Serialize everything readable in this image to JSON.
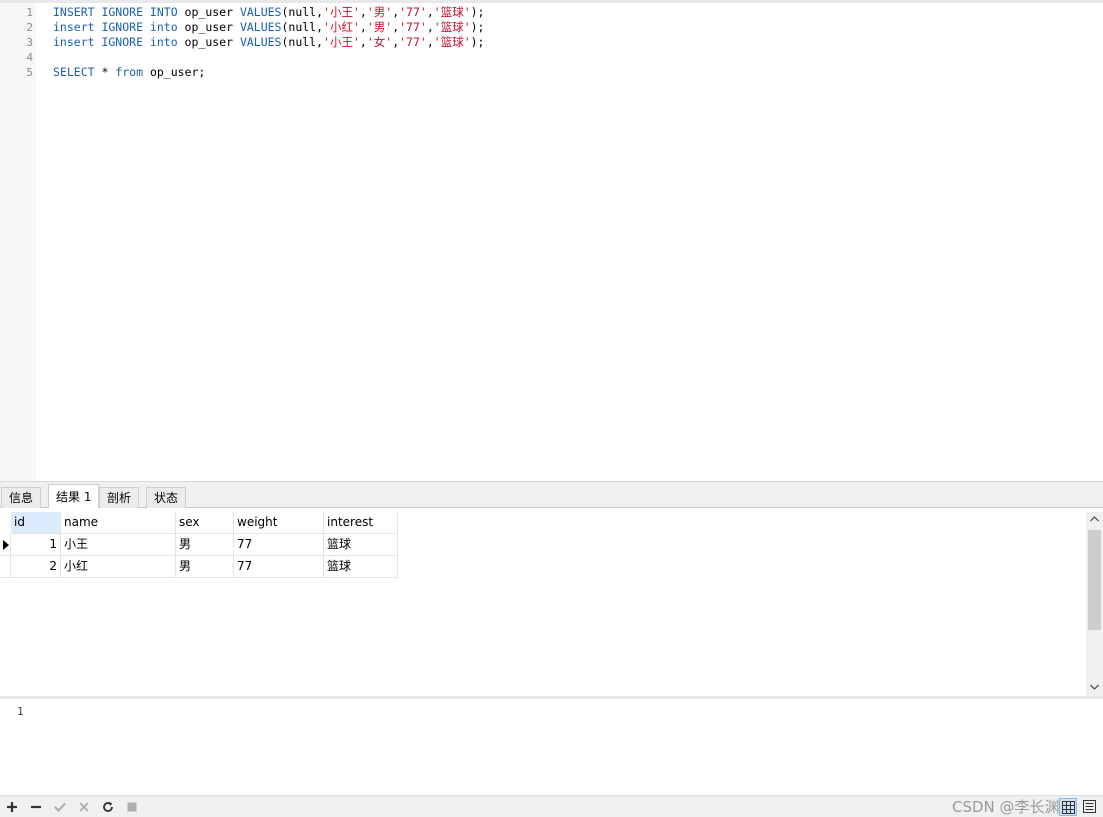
{
  "editor": {
    "line_numbers": [
      "1",
      "2",
      "3",
      "4",
      "5"
    ],
    "lines": [
      [
        {
          "t": "kw",
          "v": "INSERT IGNORE INTO"
        },
        {
          "t": "txt",
          "v": " op_user "
        },
        {
          "t": "kw",
          "v": "VALUES"
        },
        {
          "t": "txt",
          "v": "(null,"
        },
        {
          "t": "str",
          "v": "'小王'"
        },
        {
          "t": "txt",
          "v": ","
        },
        {
          "t": "str",
          "v": "'男'"
        },
        {
          "t": "txt",
          "v": ","
        },
        {
          "t": "str",
          "v": "'77'"
        },
        {
          "t": "txt",
          "v": ","
        },
        {
          "t": "str",
          "v": "'篮球'"
        },
        {
          "t": "txt",
          "v": ");"
        }
      ],
      [
        {
          "t": "kw",
          "v": "insert IGNORE into"
        },
        {
          "t": "txt",
          "v": " op_user "
        },
        {
          "t": "kw",
          "v": "VALUES"
        },
        {
          "t": "txt",
          "v": "(null,"
        },
        {
          "t": "str",
          "v": "'小红'"
        },
        {
          "t": "txt",
          "v": ","
        },
        {
          "t": "str",
          "v": "'男'"
        },
        {
          "t": "txt",
          "v": ","
        },
        {
          "t": "str",
          "v": "'77'"
        },
        {
          "t": "txt",
          "v": ","
        },
        {
          "t": "str",
          "v": "'篮球'"
        },
        {
          "t": "txt",
          "v": ");"
        }
      ],
      [
        {
          "t": "kw",
          "v": "insert IGNORE into"
        },
        {
          "t": "txt",
          "v": " op_user "
        },
        {
          "t": "kw",
          "v": "VALUES"
        },
        {
          "t": "txt",
          "v": "(null,"
        },
        {
          "t": "str",
          "v": "'小王'"
        },
        {
          "t": "txt",
          "v": ","
        },
        {
          "t": "str",
          "v": "'女'"
        },
        {
          "t": "txt",
          "v": ","
        },
        {
          "t": "str",
          "v": "'77'"
        },
        {
          "t": "txt",
          "v": ","
        },
        {
          "t": "str",
          "v": "'篮球'"
        },
        {
          "t": "txt",
          "v": ");"
        }
      ],
      [],
      [
        {
          "t": "kw",
          "v": "SELECT"
        },
        {
          "t": "txt",
          "v": " * "
        },
        {
          "t": "kw",
          "v": "from"
        },
        {
          "t": "txt",
          "v": " op_user;"
        }
      ]
    ]
  },
  "tabs": [
    {
      "label": "信息",
      "active": false
    },
    {
      "label": "结果 1",
      "active": true
    },
    {
      "label": "剖析",
      "active": false
    },
    {
      "label": "状态",
      "active": false
    }
  ],
  "results": {
    "columns": [
      "id",
      "name",
      "sex",
      "weight",
      "interest"
    ],
    "rows": [
      {
        "id": "1",
        "name": "小王",
        "sex": "男",
        "weight": "77",
        "interest": "篮球"
      },
      {
        "id": "2",
        "name": "小红",
        "sex": "男",
        "weight": "77",
        "interest": "篮球"
      }
    ]
  },
  "messages": {
    "line_number": "1"
  },
  "toolbar": {
    "add_icon": "plus-icon",
    "remove_icon": "minus-icon",
    "apply_icon": "check-icon",
    "discard_icon": "x-icon",
    "refresh_icon": "refresh-icon",
    "stop_icon": "stop-icon",
    "watermark": "CSDN @李长渊哦",
    "grid_view_icon": "grid-view-icon",
    "form_view_icon": "form-view-icon"
  },
  "colors": {
    "keyword": "#1a5fb4",
    "string": "#c8102e",
    "header_selected": "#dcebfb"
  }
}
